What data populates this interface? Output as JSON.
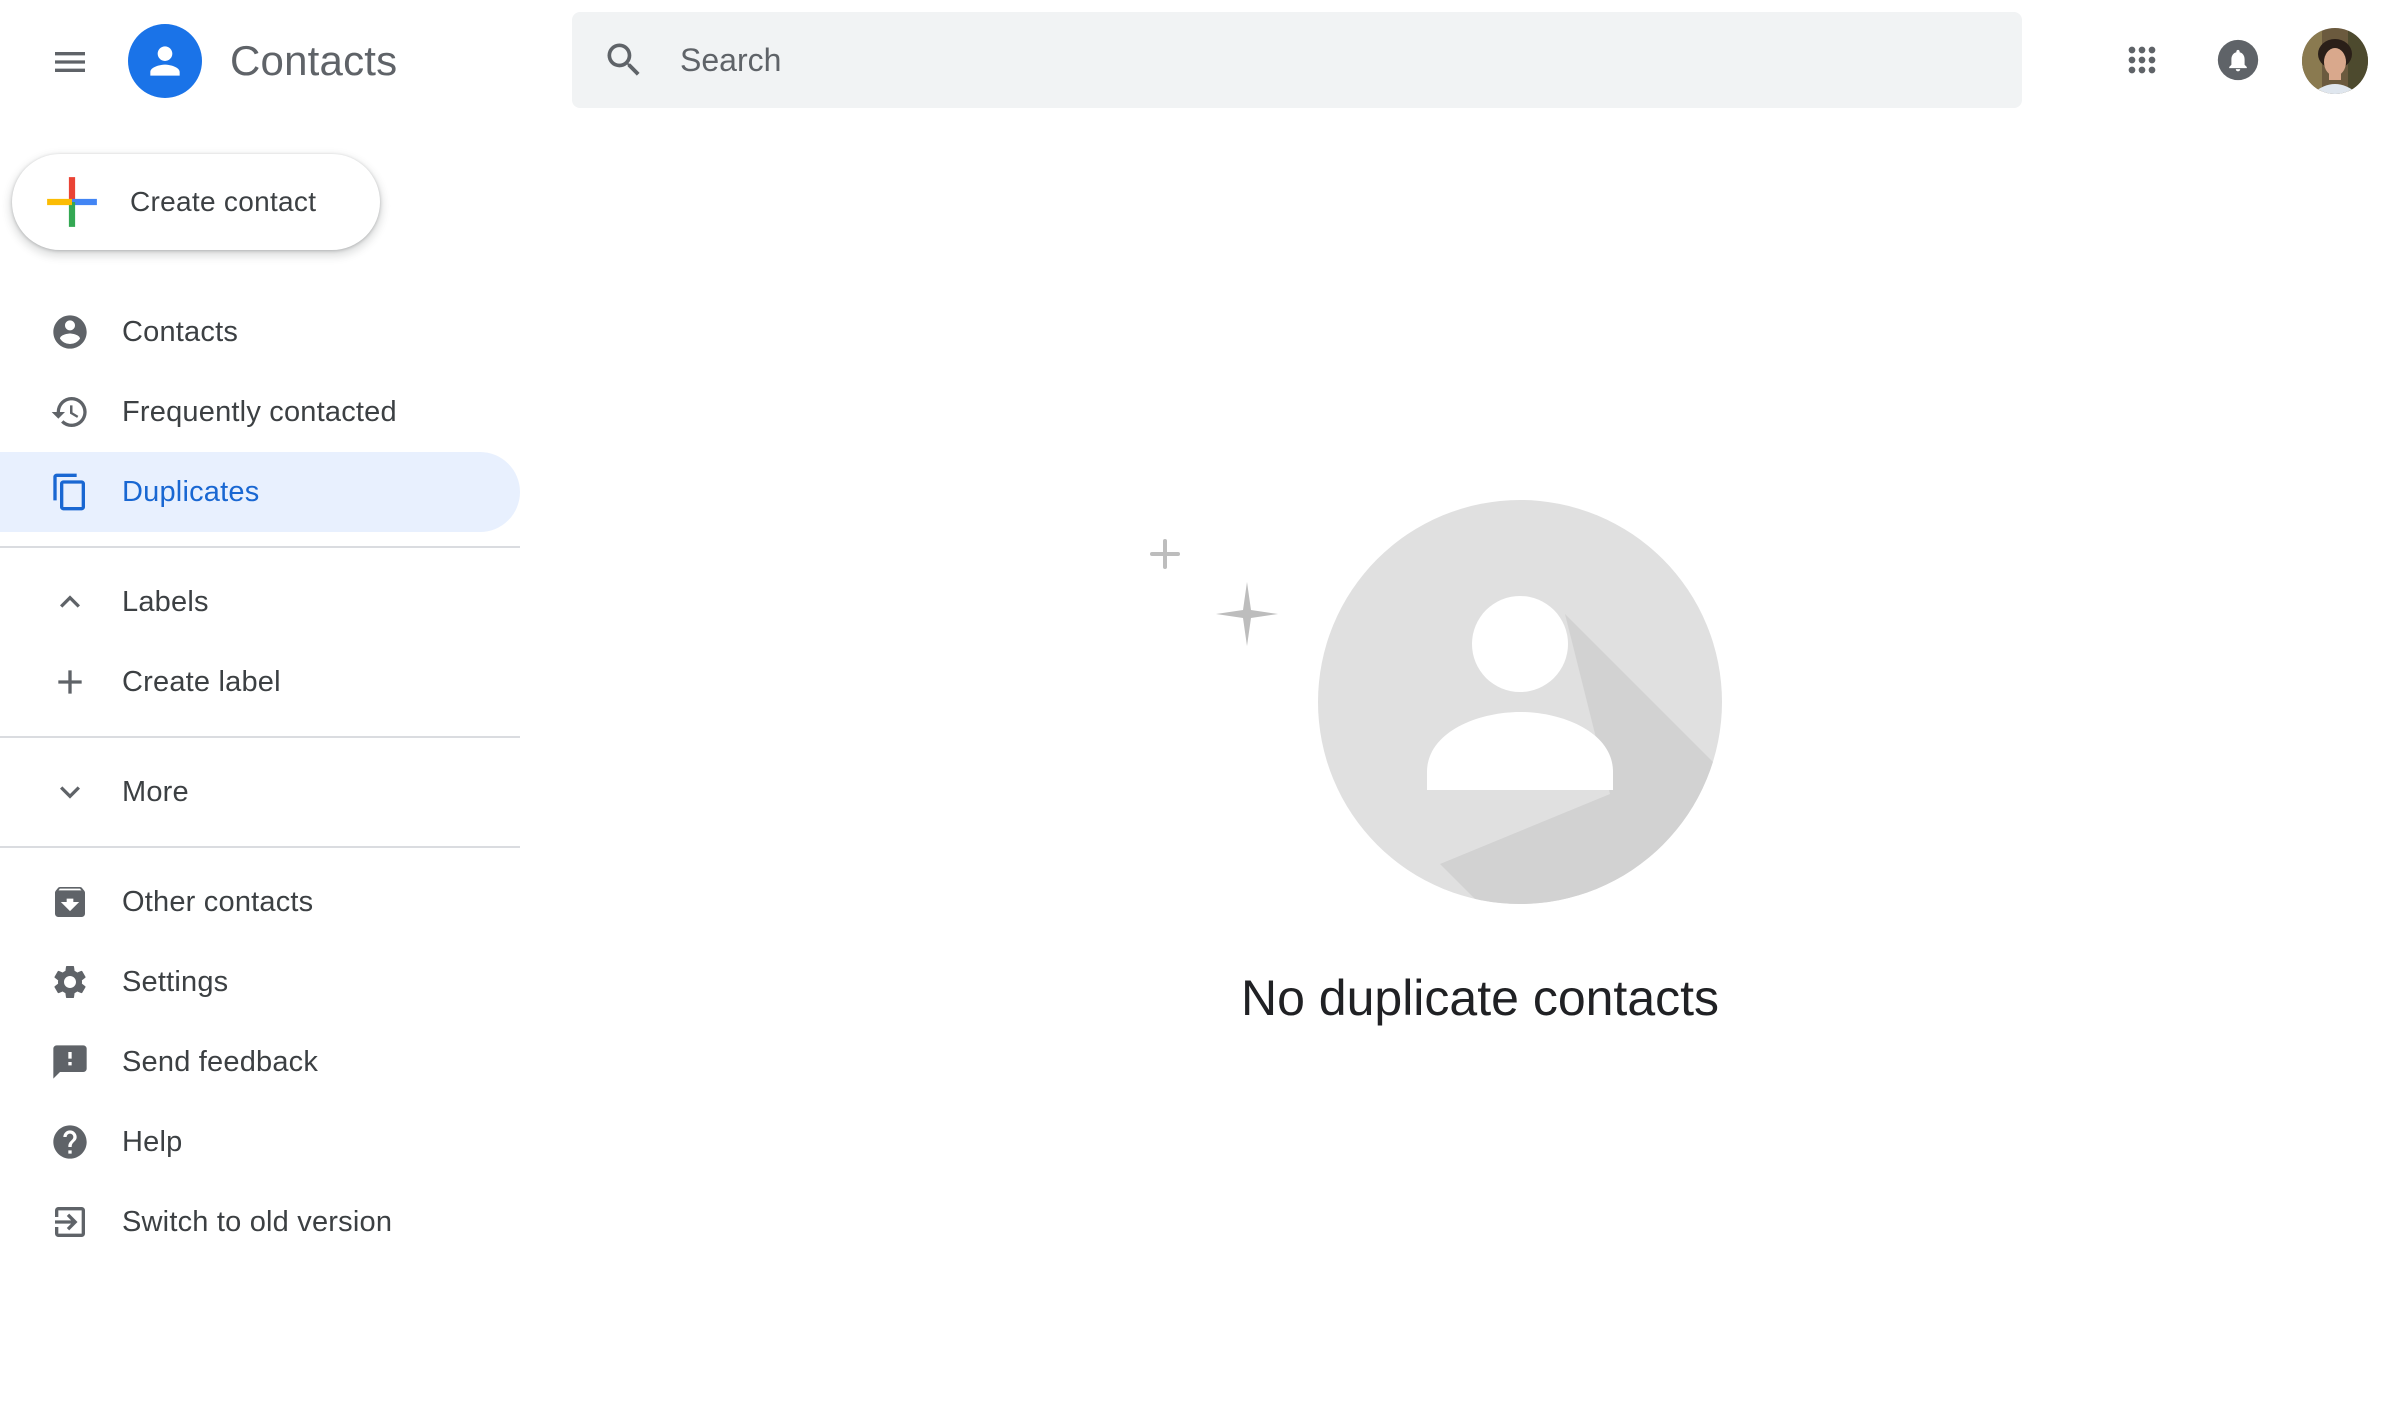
{
  "header": {
    "app_title": "Contacts",
    "search_placeholder": "Search"
  },
  "sidebar": {
    "create_label": "Create contact",
    "primary_items": [
      {
        "label": "Contacts",
        "icon": "person-circle-icon"
      },
      {
        "label": "Frequently contacted",
        "icon": "history-icon"
      },
      {
        "label": "Duplicates",
        "icon": "duplicate-icon",
        "active": true
      }
    ],
    "labels_section": {
      "header": "Labels",
      "create_label": "Create label"
    },
    "more_label": "More",
    "secondary_items": [
      {
        "label": "Other contacts",
        "icon": "archive-icon"
      },
      {
        "label": "Settings",
        "icon": "gear-icon"
      },
      {
        "label": "Send feedback",
        "icon": "feedback-icon"
      },
      {
        "label": "Help",
        "icon": "help-icon"
      },
      {
        "label": "Switch to old version",
        "icon": "exit-icon"
      }
    ]
  },
  "main": {
    "empty_message": "No duplicate contacts"
  },
  "colors": {
    "accent": "#1a73e8",
    "active_bg": "#e8f0fe",
    "active_text": "#1967d2",
    "icon_gray": "#5f6368",
    "search_bg": "#f1f3f4"
  }
}
